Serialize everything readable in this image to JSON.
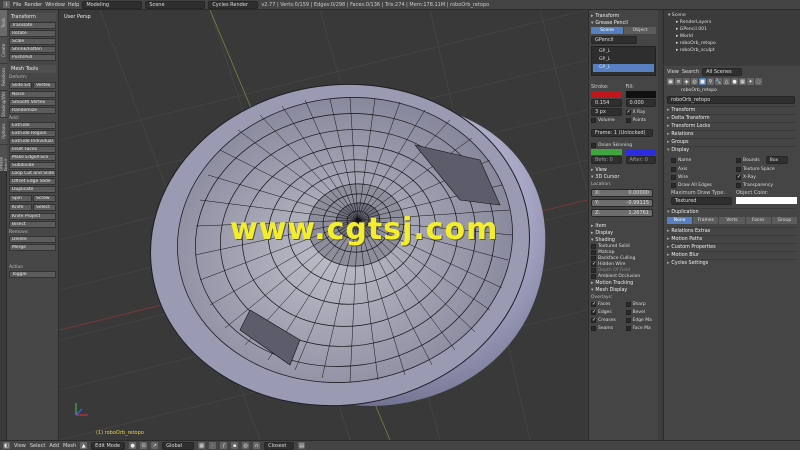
{
  "topbar": {
    "menus": [
      "File",
      "Render",
      "Window",
      "Help"
    ],
    "layout": "Modeling",
    "scene": "Scene",
    "engine": "Cycles Render",
    "stats": "v2.77 | Verts:0/159 | Edges:0/298 | Faces:0/136 | Tris:274 | Mem:178.11M | roboOrb_retopo"
  },
  "vtabs": [
    "Tools",
    "Create",
    "Relations",
    "Shading/UVs",
    "Options",
    "Grease Pencil"
  ],
  "toolshelf": {
    "transform_title": "Transform",
    "transform_buttons": [
      "Translate",
      "Rotate",
      "Scale",
      "Shrink/Fatten",
      "Push/Pull"
    ],
    "meshtools_title": "Mesh Tools",
    "deform_label": "Deform:",
    "slide_edge": "Slide Ed",
    "vertex": "Vertex",
    "deform_buttons": [
      "Noise",
      "Smooth Vertex",
      "Randomize"
    ],
    "add_label": "Add:",
    "extrude": "Extrude",
    "add_buttons": [
      "Extrude Region",
      "Extrude Individual",
      "Inset Faces",
      "Make Edge/Face",
      "Subdivide",
      "Loop Cut and Slide",
      "Offset Edge Slide",
      "Duplicate"
    ],
    "spin": "Spin",
    "screw": "Screw",
    "knife": "Knife",
    "select": "Select",
    "knife_project": "Knife Project",
    "bisect": "Bisect",
    "remove_label": "Remove:",
    "delete": "Delete",
    "merge": "Merge",
    "action_label": "Action",
    "action_value": "Toggle"
  },
  "viewport": {
    "label": "User Persp",
    "object_label": "(1) roboOrb_retopo",
    "watermark": "www.cgtsj.com"
  },
  "npanel": {
    "transform": "Transform",
    "grease_pencil": "Grease Pencil",
    "scene_btn": "Scene",
    "object_btn": "Object",
    "gpencil_field": "GPencil",
    "layers": [
      "GP_L",
      "GP_L",
      "GP_L"
    ],
    "stroke_label": "Stroke:",
    "fill_label": "Fill:",
    "stroke_value": "0.154",
    "fill_value": "0.000",
    "px_value": "3 px",
    "xray": "X Ray",
    "volume": "Volume",
    "points": "Points",
    "frame_field": "Frame: 1 (Unlocked)",
    "onion_skinning": "Onion Skinning",
    "before_label": "Befo: 0",
    "after_label": "After: 0",
    "view": "View",
    "cursor": "3D Cursor",
    "location_label": "Location:",
    "x": "0.00000",
    "y": "-0.99115",
    "z": "1.26761",
    "item": "Item",
    "display": "Display",
    "shading": "Shading",
    "shading_opts": [
      {
        "label": "Textured Solid",
        "on": false
      },
      {
        "label": "Matcap",
        "on": false
      },
      {
        "label": "Backface Culling",
        "on": false
      },
      {
        "label": "Hidden Wire",
        "on": true
      },
      {
        "label": "Depth Of Field",
        "on": false
      },
      {
        "label": "Ambient Occlusion",
        "on": false
      }
    ],
    "motion_tracking": "Motion Tracking",
    "mesh_display": "Mesh Display",
    "overlays_label": "Overlays:",
    "overlay_left": [
      {
        "label": "Faces",
        "on": true
      },
      {
        "label": "Edges",
        "on": true
      },
      {
        "label": "Creases",
        "on": true
      },
      {
        "label": "Seams",
        "on": false
      }
    ],
    "overlay_right": [
      {
        "label": "Sharp",
        "on": false
      },
      {
        "label": "Bevel",
        "on": false
      },
      {
        "label": "Edge Ma",
        "on": false
      },
      {
        "label": "Face Ma",
        "on": false
      }
    ]
  },
  "outliner": {
    "rows": [
      "Scene",
      "RenderLayers",
      "GPencil.001",
      "World",
      "roboOrb_retopo",
      "roboOrb_sculpt"
    ]
  },
  "props": {
    "view": "View",
    "search": "Search",
    "all_scenes": "All Scenes",
    "breadcrumb": "roboOrb_retopo",
    "object_name": "roboOrb_retopo",
    "sections_top": [
      "Transform",
      "Delta Transform",
      "Transform Locks",
      "Relations",
      "Groups"
    ],
    "display": "Display",
    "name": "Name",
    "bounds": "Bounds",
    "box": "Box",
    "axis": "Axis",
    "texture_space": "Texture Space",
    "wire": "Wire",
    "xray": "X-Ray",
    "draw_all_edges": "Draw All Edges",
    "transparency": "Transparency",
    "max_draw_type": "Maximum Draw Type:",
    "object_color": "Object Color:",
    "textured": "Textured",
    "duplication": "Duplication",
    "dup_modes": [
      "None",
      "Frames",
      "Verts",
      "Faces",
      "Group"
    ],
    "sections_bottom": [
      "Relations Extras",
      "Motion Paths",
      "Custom Properties",
      "Motion Blur",
      "Cycles Settings"
    ]
  },
  "footer": {
    "view": "View",
    "select": "Select",
    "add": "Add",
    "mesh": "Mesh",
    "mode": "Edit Mode",
    "pivot": "Global",
    "snap": "Closest"
  },
  "colors": {
    "stroke": "#c0171f",
    "fill": "#101010",
    "before_color": "#3fa53f",
    "after_color": "#2d2de0",
    "accent": "#5680c2",
    "watermark": "#f4ee2a"
  }
}
